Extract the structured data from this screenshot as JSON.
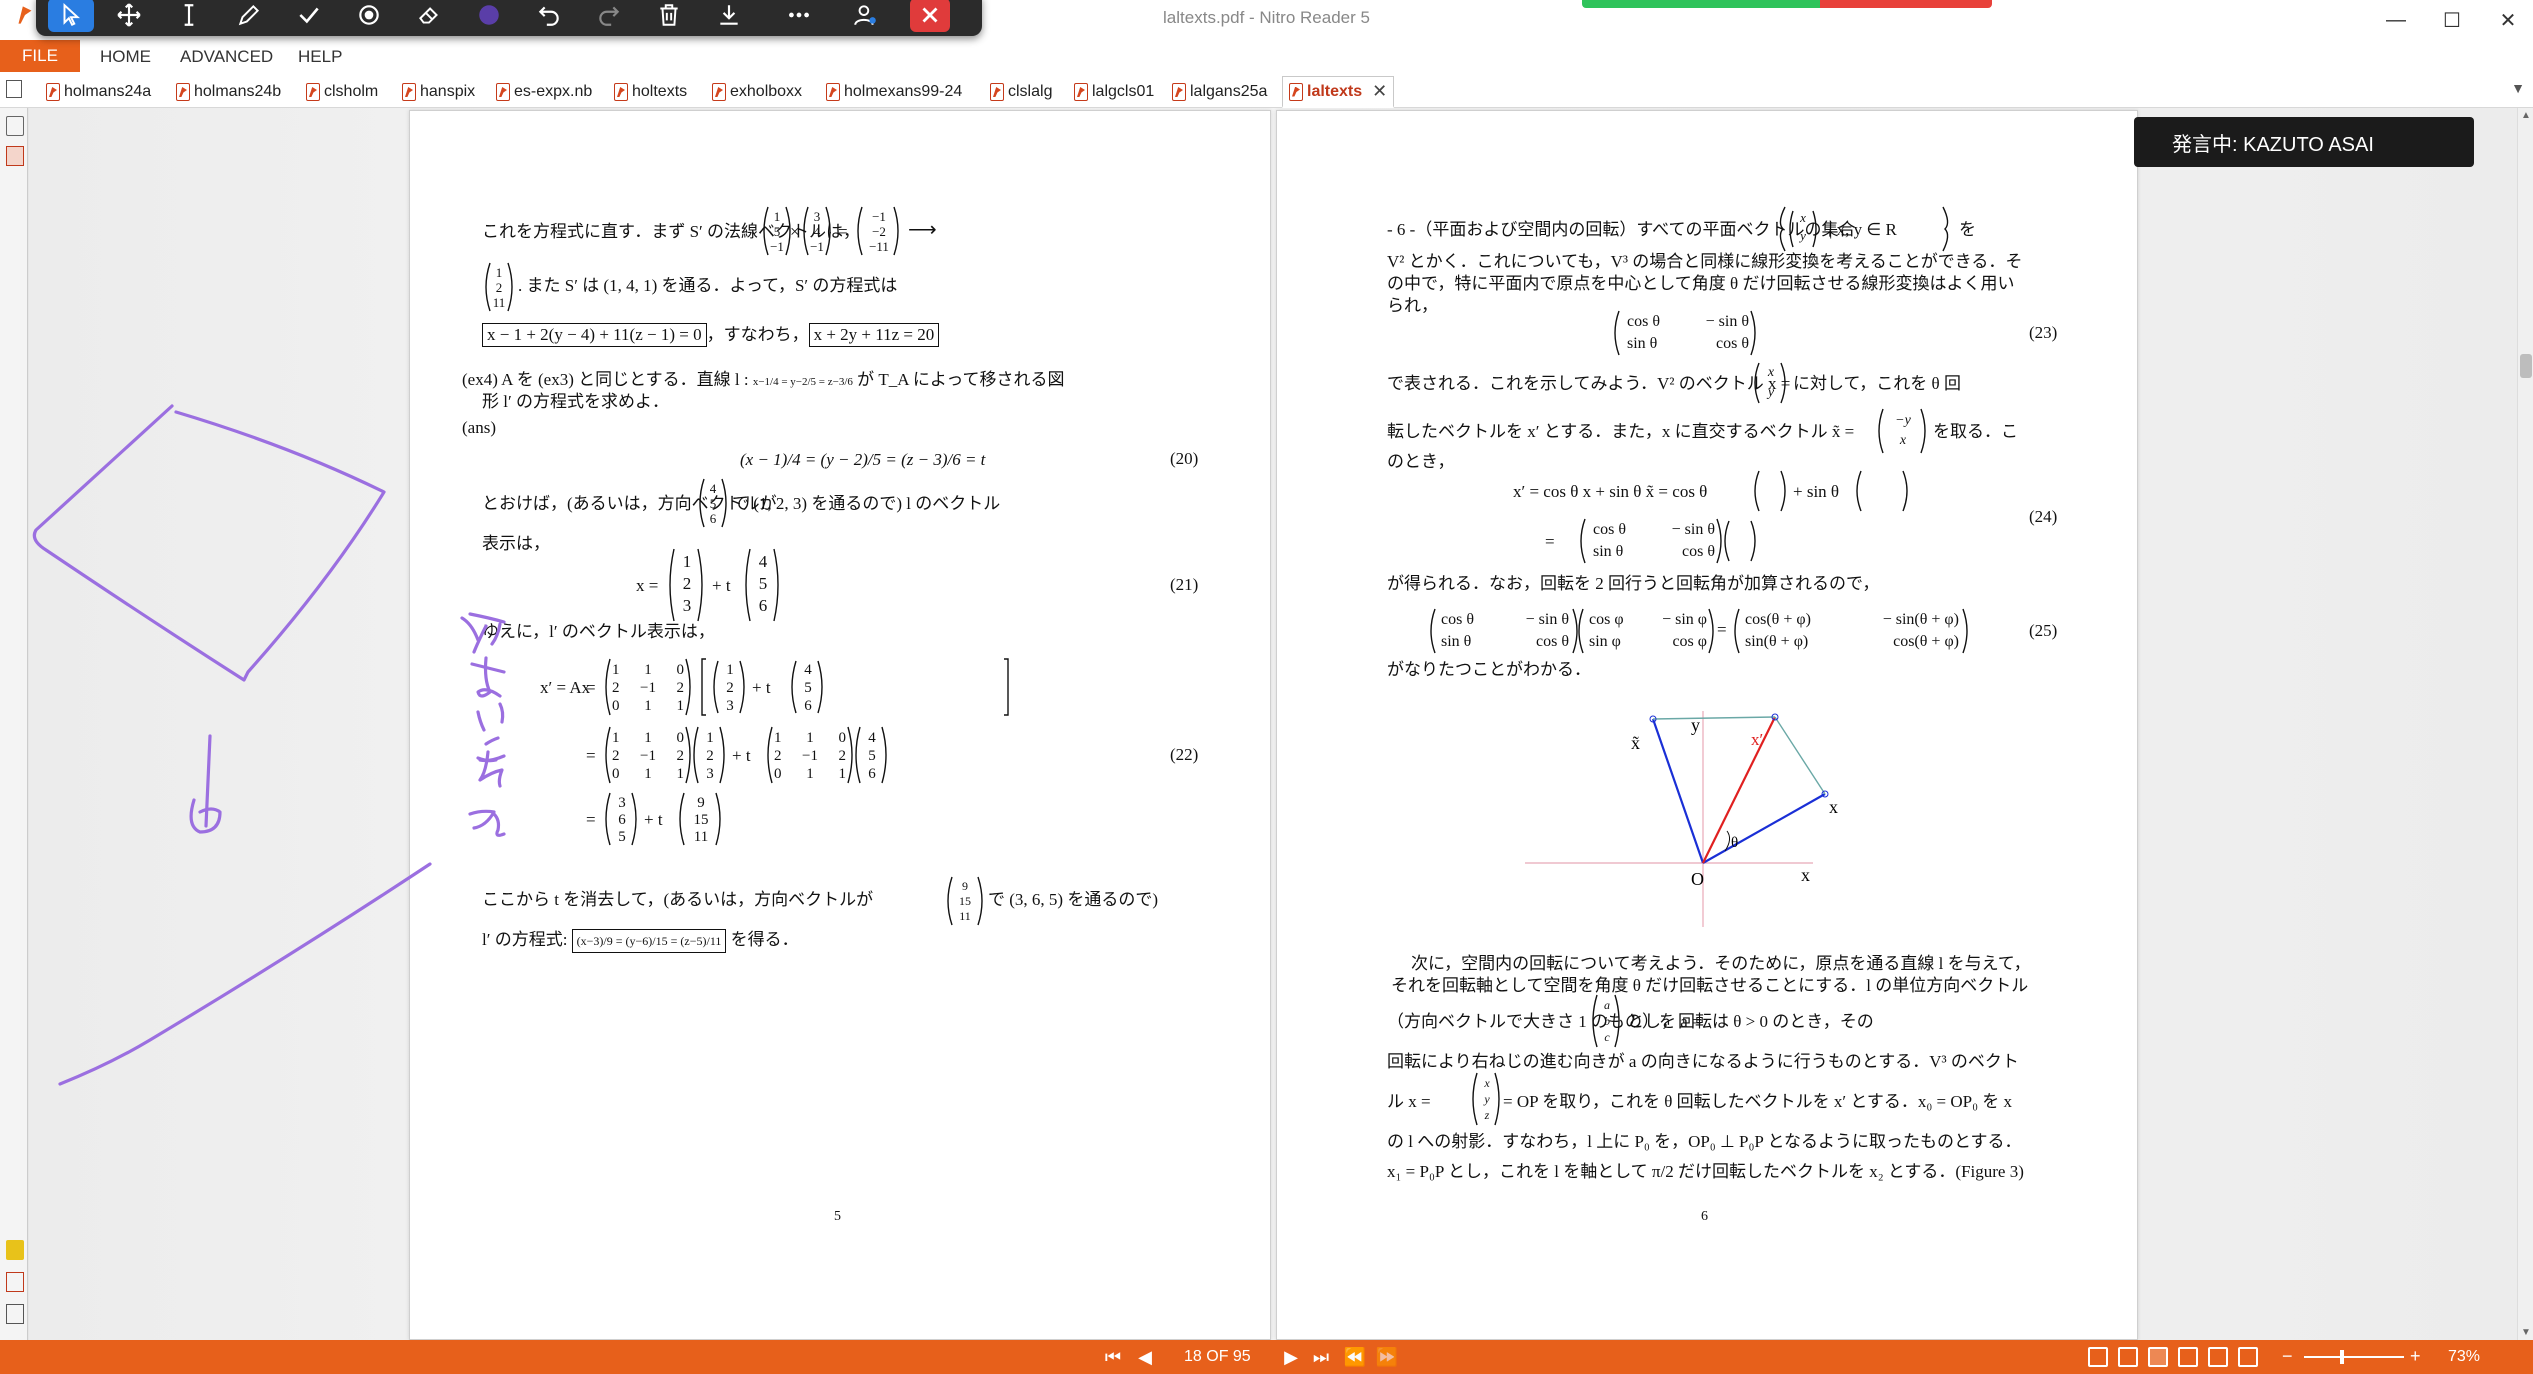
{
  "window": {
    "title": "laltexts.pdf - Nitro Reader 5",
    "minimize": "—",
    "maximize": "☐",
    "close": "✕"
  },
  "menu": [
    "FILE",
    "HOME",
    "ADVANCED",
    "HELP"
  ],
  "tabs": [
    {
      "label": "holmans24a"
    },
    {
      "label": "holmans24b"
    },
    {
      "label": "clsholm"
    },
    {
      "label": "hanspix"
    },
    {
      "label": "es-expx.nb"
    },
    {
      "label": "holtexts"
    },
    {
      "label": "exholboxx"
    },
    {
      "label": "holmexans99-24"
    },
    {
      "label": "clslalg"
    },
    {
      "label": "lalgcls01"
    },
    {
      "label": "lalgans25a"
    },
    {
      "label": "laltexts",
      "active": true
    }
  ],
  "speaker": "発言中: KAZUTO ASAI",
  "page5": {
    "l1a": "これを方程式に直す．まず S′ の法線ベクトルは，",
    "v1": [
      "1",
      "5",
      "−1"
    ],
    "v2": [
      "3",
      "4",
      "−1"
    ],
    "v3": [
      "−1",
      "−2",
      "−11"
    ],
    "times": "×",
    "eq": "=",
    "arrow": "⟶",
    "v4": [
      "1",
      "2",
      "11"
    ],
    "l2": ". また S′ は (1, 4, 1) を通る．よって，S′ の方程式は",
    "box1": "x − 1 + 2(y − 4) + 11(z − 1) = 0",
    "l3": "，すなわち，",
    "box2": "x + 2y + 11z = 20",
    "ex4a": "(ex4)  A を (ex3) と同じとする．直線 l :",
    "ex4frac": "x−1/4 = y−2/5 = z−3/6",
    "ex4b": "が T_A によって移される図",
    "ex4c": "形 l′ の方程式を求めよ．",
    "ans": "(ans)",
    "eq20": "(x − 1)/4 = (y − 2)/5 = (z − 3)/6 = t",
    "eq20no": "(20)",
    "l4a": "とおけば，(あるいは，方向ベクトルが",
    "v5": [
      "4",
      "5",
      "6"
    ],
    "l4b": "で (1, 2, 3) を通るので) l のベクトル",
    "l5": "表示は，",
    "eq21lhs": "x =",
    "v6": [
      "1",
      "2",
      "3"
    ],
    "plus_t": "+ t",
    "eq21no": "(21)",
    "l6": "ゆえに，l′ のベクトル表示は，",
    "eq22lhs": "x′ = Ax",
    "matA": [
      [
        "1",
        "1",
        "0"
      ],
      [
        "2",
        "−1",
        "2"
      ],
      [
        "0",
        "1",
        "1"
      ]
    ],
    "v7": [
      "3",
      "6",
      "5"
    ],
    "v8": [
      "9",
      "15",
      "11"
    ],
    "eq22no": "(22)",
    "l7a": "ここから t を消去して，(あるいは，方向ベクトルが",
    "l7b": "で (3, 6, 5) を通るので)",
    "l8a": "l′ の方程式:",
    "box3": "(x−3)/9 = (y−6)/15 = (z−5)/11",
    "l8b": "を得る．",
    "pagenum": "5"
  },
  "page6": {
    "p1a": "- 6 -（平面および空間内の回転）すべての平面ベクトルの集合",
    "set": "x, y ∈ R",
    "p1b": "を",
    "p2": "V² とかく．これについても，V³ の場合と同様に線形変換を考えることができる．そ",
    "p3": "の中で，特に平面内で原点を中心として角度 θ だけ回転させる線形変換はよく用い",
    "p4": "られ，",
    "rot": [
      [
        "cos θ",
        "− sin θ"
      ],
      [
        "sin θ",
        "cos θ"
      ]
    ],
    "eq23no": "(23)",
    "p5a": "で表される．これを示してみよう．V² のベクトル x =",
    "p5b": "に対して，これを θ 回",
    "p6a": "転したベクトルを x′ とする．また，x に直交するベクトル x̃ =",
    "p6b": "を取る．こ",
    "p7": "のとき，",
    "eq24a": "x′ = cos θ x + sin θ x̃ = cos θ",
    "eq24b": "+ sin θ",
    "eq24no": "(24)",
    "p8": "が得られる．なお，回転を 2 回行うと回転角が加算されるので，",
    "rot2": [
      [
        "cos φ",
        "− sin φ"
      ],
      [
        "sin φ",
        "cos φ"
      ]
    ],
    "rot3": [
      [
        "cos(θ + φ)",
        "− sin(θ + φ)"
      ],
      [
        "sin(θ + φ)",
        "cos(θ + φ)"
      ]
    ],
    "eq25no": "(25)",
    "p9": "がなりたつことがわかる．",
    "fig": {
      "x_tilde": "x̃",
      "y": "y",
      "x_prime": "x′",
      "x": "x",
      "theta": "θ",
      "O": "O",
      "xaxis": "x"
    },
    "q1": "次に，空間内の回転について考えよう．そのために，原点を通る直線 l を与えて，",
    "q2": "それを回転軸として空間を角度 θ だけ回転させることにする．l の単位方向ベクトル",
    "q3a": "（方向ベクトルで大きさ 1 のもの）を a =",
    "q3b": "とし，回転は θ > 0 のとき，その",
    "q4": "回転により右ねじの進む向きが a の向きになるように行うものとする．V³ のベクト",
    "q5a": "ル x =",
    "q5b": "= OP を取り，これを θ 回転したベクトルを x′ とする．x₀ = OP₀ を x",
    "q6": "の l への射影．すなわち，l 上に P₀ を，OP₀ ⊥ P₀P となるように取ったものとする．",
    "q7": "x₁ = P₀P とし，これを l を軸として π/2 だけ回転したベクトルを x₂ とする．(Figure 3)",
    "pagenum": "6"
  },
  "status": {
    "page": "18 OF 95",
    "zoom": "73%",
    "zoom_minus": "−",
    "zoom_plus": "+"
  },
  "ink_color": "#9b6fe0",
  "brand_color": "#e7601b"
}
